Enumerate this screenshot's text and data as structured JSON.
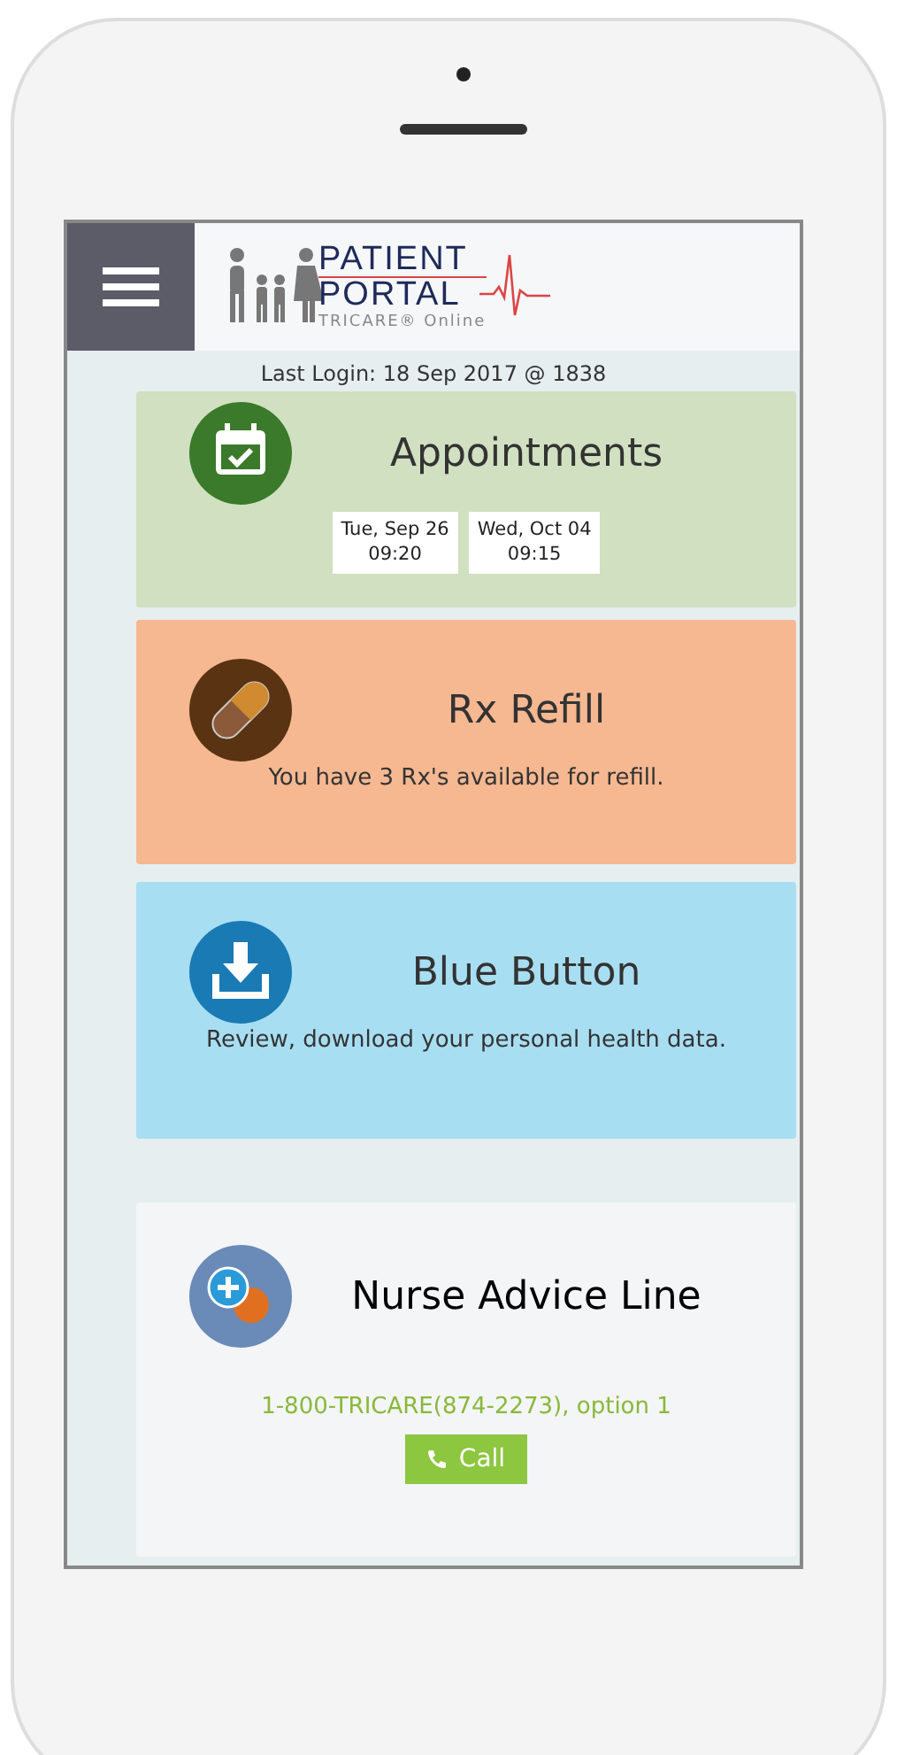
{
  "header": {
    "logo": {
      "line_1": "PATIENT",
      "line_2": "PORTAL",
      "tagline": "TRICARE® Online"
    }
  },
  "last_login": "Last Login:  18 Sep 2017 @ 1838",
  "cards": [
    {
      "kind": "appointments",
      "title": "Appointments",
      "color": "#d0e0c0",
      "dates": [
        {
          "day": "Tue, Sep 26",
          "time": "09:20"
        },
        {
          "day": "Wed, Oct 04",
          "time": "09:15"
        }
      ]
    },
    {
      "kind": "rx",
      "title": "Rx Refill",
      "color": "#f6b891",
      "text": "You have 3 Rx's available for refill."
    },
    {
      "kind": "download",
      "title": "Blue Button",
      "color": "#a8def2",
      "text": "Review, download your personal health data."
    },
    {
      "kind": "nurse",
      "title": "Nurse Advice Line",
      "color": "#f3f5f7",
      "phone": "1-800-TRICARE(874-2273), option 1",
      "button": "Call"
    }
  ]
}
